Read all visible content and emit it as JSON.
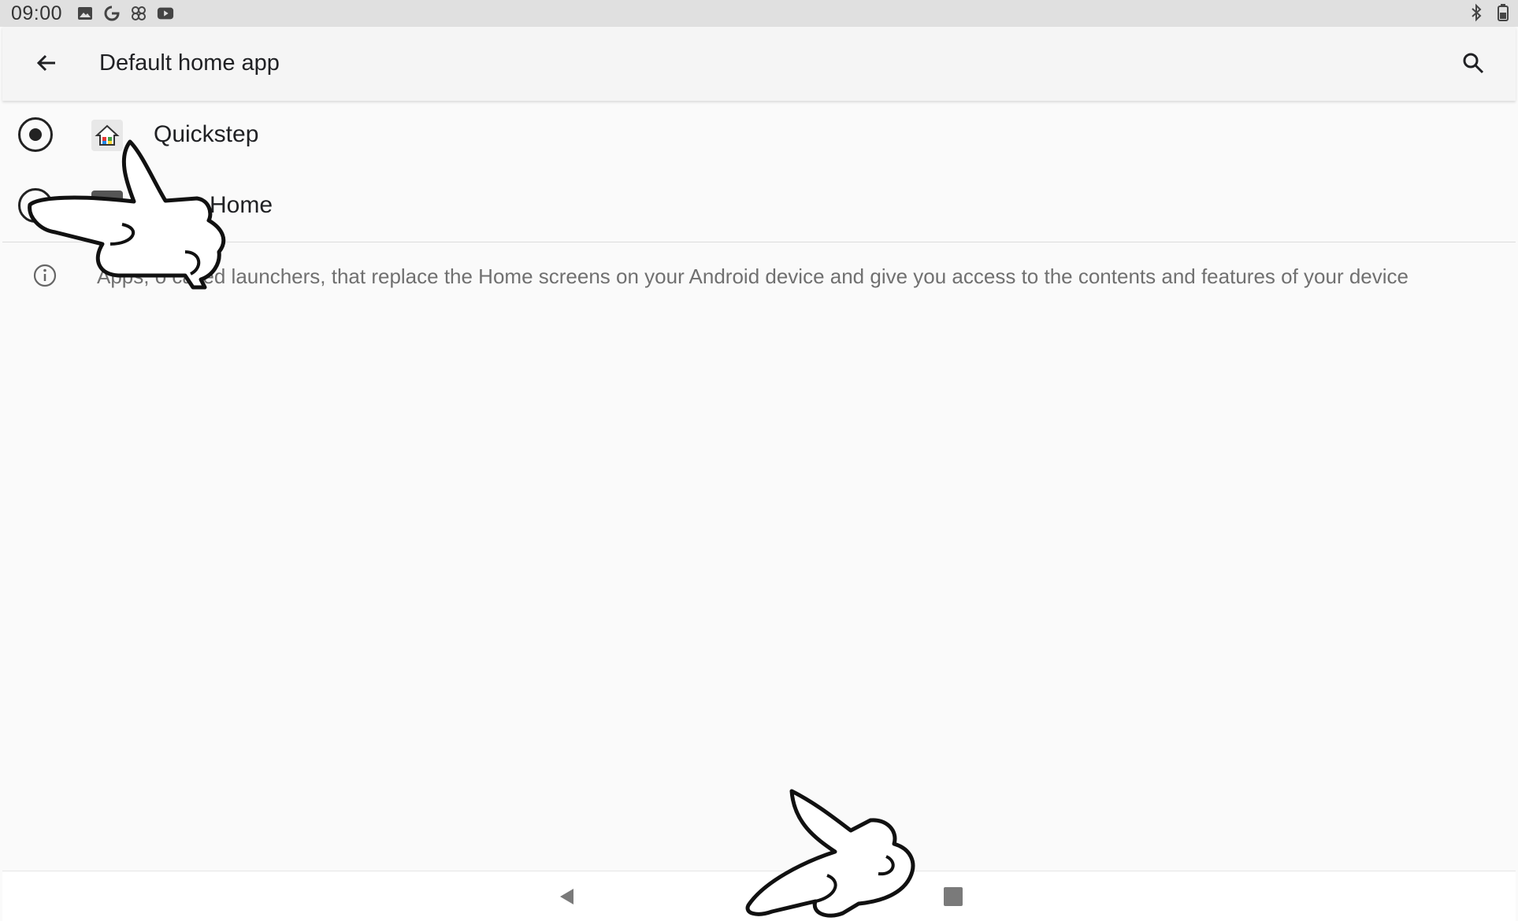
{
  "status_bar": {
    "time": "09:00",
    "left_icons": [
      "photo-icon",
      "google-icon",
      "pinwheel-icon",
      "youtube-icon"
    ],
    "right_icons": [
      "bluetooth-icon",
      "battery-icon"
    ]
  },
  "app_bar": {
    "title": "Default home app",
    "back_icon": "arrow-back-icon",
    "search_icon": "search-icon"
  },
  "options": [
    {
      "label": "Quickstep",
      "selected": true,
      "icon": "home-icon"
    },
    {
      "label": "re Home",
      "selected": false,
      "icon": "app-icon"
    }
  ],
  "info": {
    "text": "Apps, o    called launchers, that replace the Home screens on your Android device and give you access to the contents and features of your device"
  },
  "nav_bar": {
    "items": [
      "back",
      "home",
      "recents"
    ]
  },
  "colors": {
    "status_bar_bg": "#e0e0e0",
    "app_bar_bg": "#f5f5f5",
    "page_bg": "#fafafa",
    "text_primary": "#202124",
    "text_secondary": "#707070"
  }
}
